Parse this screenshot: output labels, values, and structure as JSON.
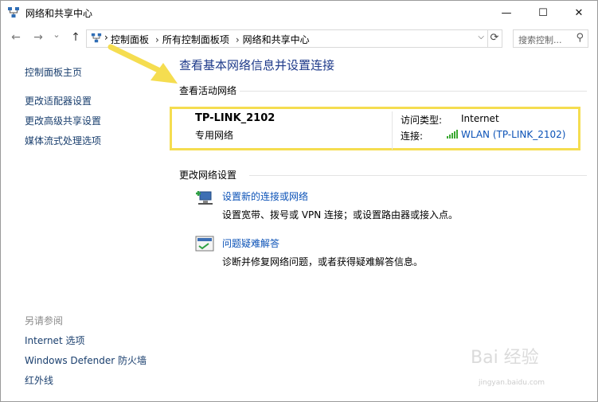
{
  "window": {
    "title": "网络和共享中心"
  },
  "window_controls": {
    "minimize": "—",
    "maximize": "☐",
    "close": "✕"
  },
  "nav": {
    "back": "←",
    "forward": "→",
    "recent": "⌄",
    "up": "↑"
  },
  "address": {
    "crumbs": [
      "控制面板",
      "所有控制面板项",
      "网络和共享中心"
    ],
    "separator": "›",
    "dropdown": "⌵",
    "refresh": "⟳"
  },
  "search": {
    "placeholder": "搜索控制...",
    "icon": "⚲"
  },
  "sidebar": {
    "home": "控制面板主页",
    "items": [
      "更改适配器设置",
      "更改高级共享设置",
      "媒体流式处理选项"
    ],
    "see_also_title": "另请参阅",
    "see_also": [
      "Internet 选项",
      "Windows Defender 防火墙",
      "红外线"
    ]
  },
  "main": {
    "heading": "查看基本网络信息并设置连接",
    "active_title": "查看活动网络",
    "network": {
      "name": "TP-LINK_2102",
      "category": "专用网络",
      "access_label": "访问类型:",
      "access_value": "Internet",
      "conn_label": "连接:",
      "conn_value": "WLAN (TP-LINK_2102)"
    },
    "change_title": "更改网络设置",
    "tasks": [
      {
        "title": "设置新的连接或网络",
        "desc": "设置宽带、拨号或 VPN 连接；或设置路由器或接入点。"
      },
      {
        "title": "问题疑难解答",
        "desc": "诊断并修复网络问题，或者获得疑难解答信息。"
      }
    ]
  },
  "watermark": {
    "text": "Bai 经验",
    "sub": "jingyan.baidu.com"
  },
  "colors": {
    "highlight": "#f5dd50",
    "link": "#0b52b7",
    "heading": "#1e3a8a"
  }
}
